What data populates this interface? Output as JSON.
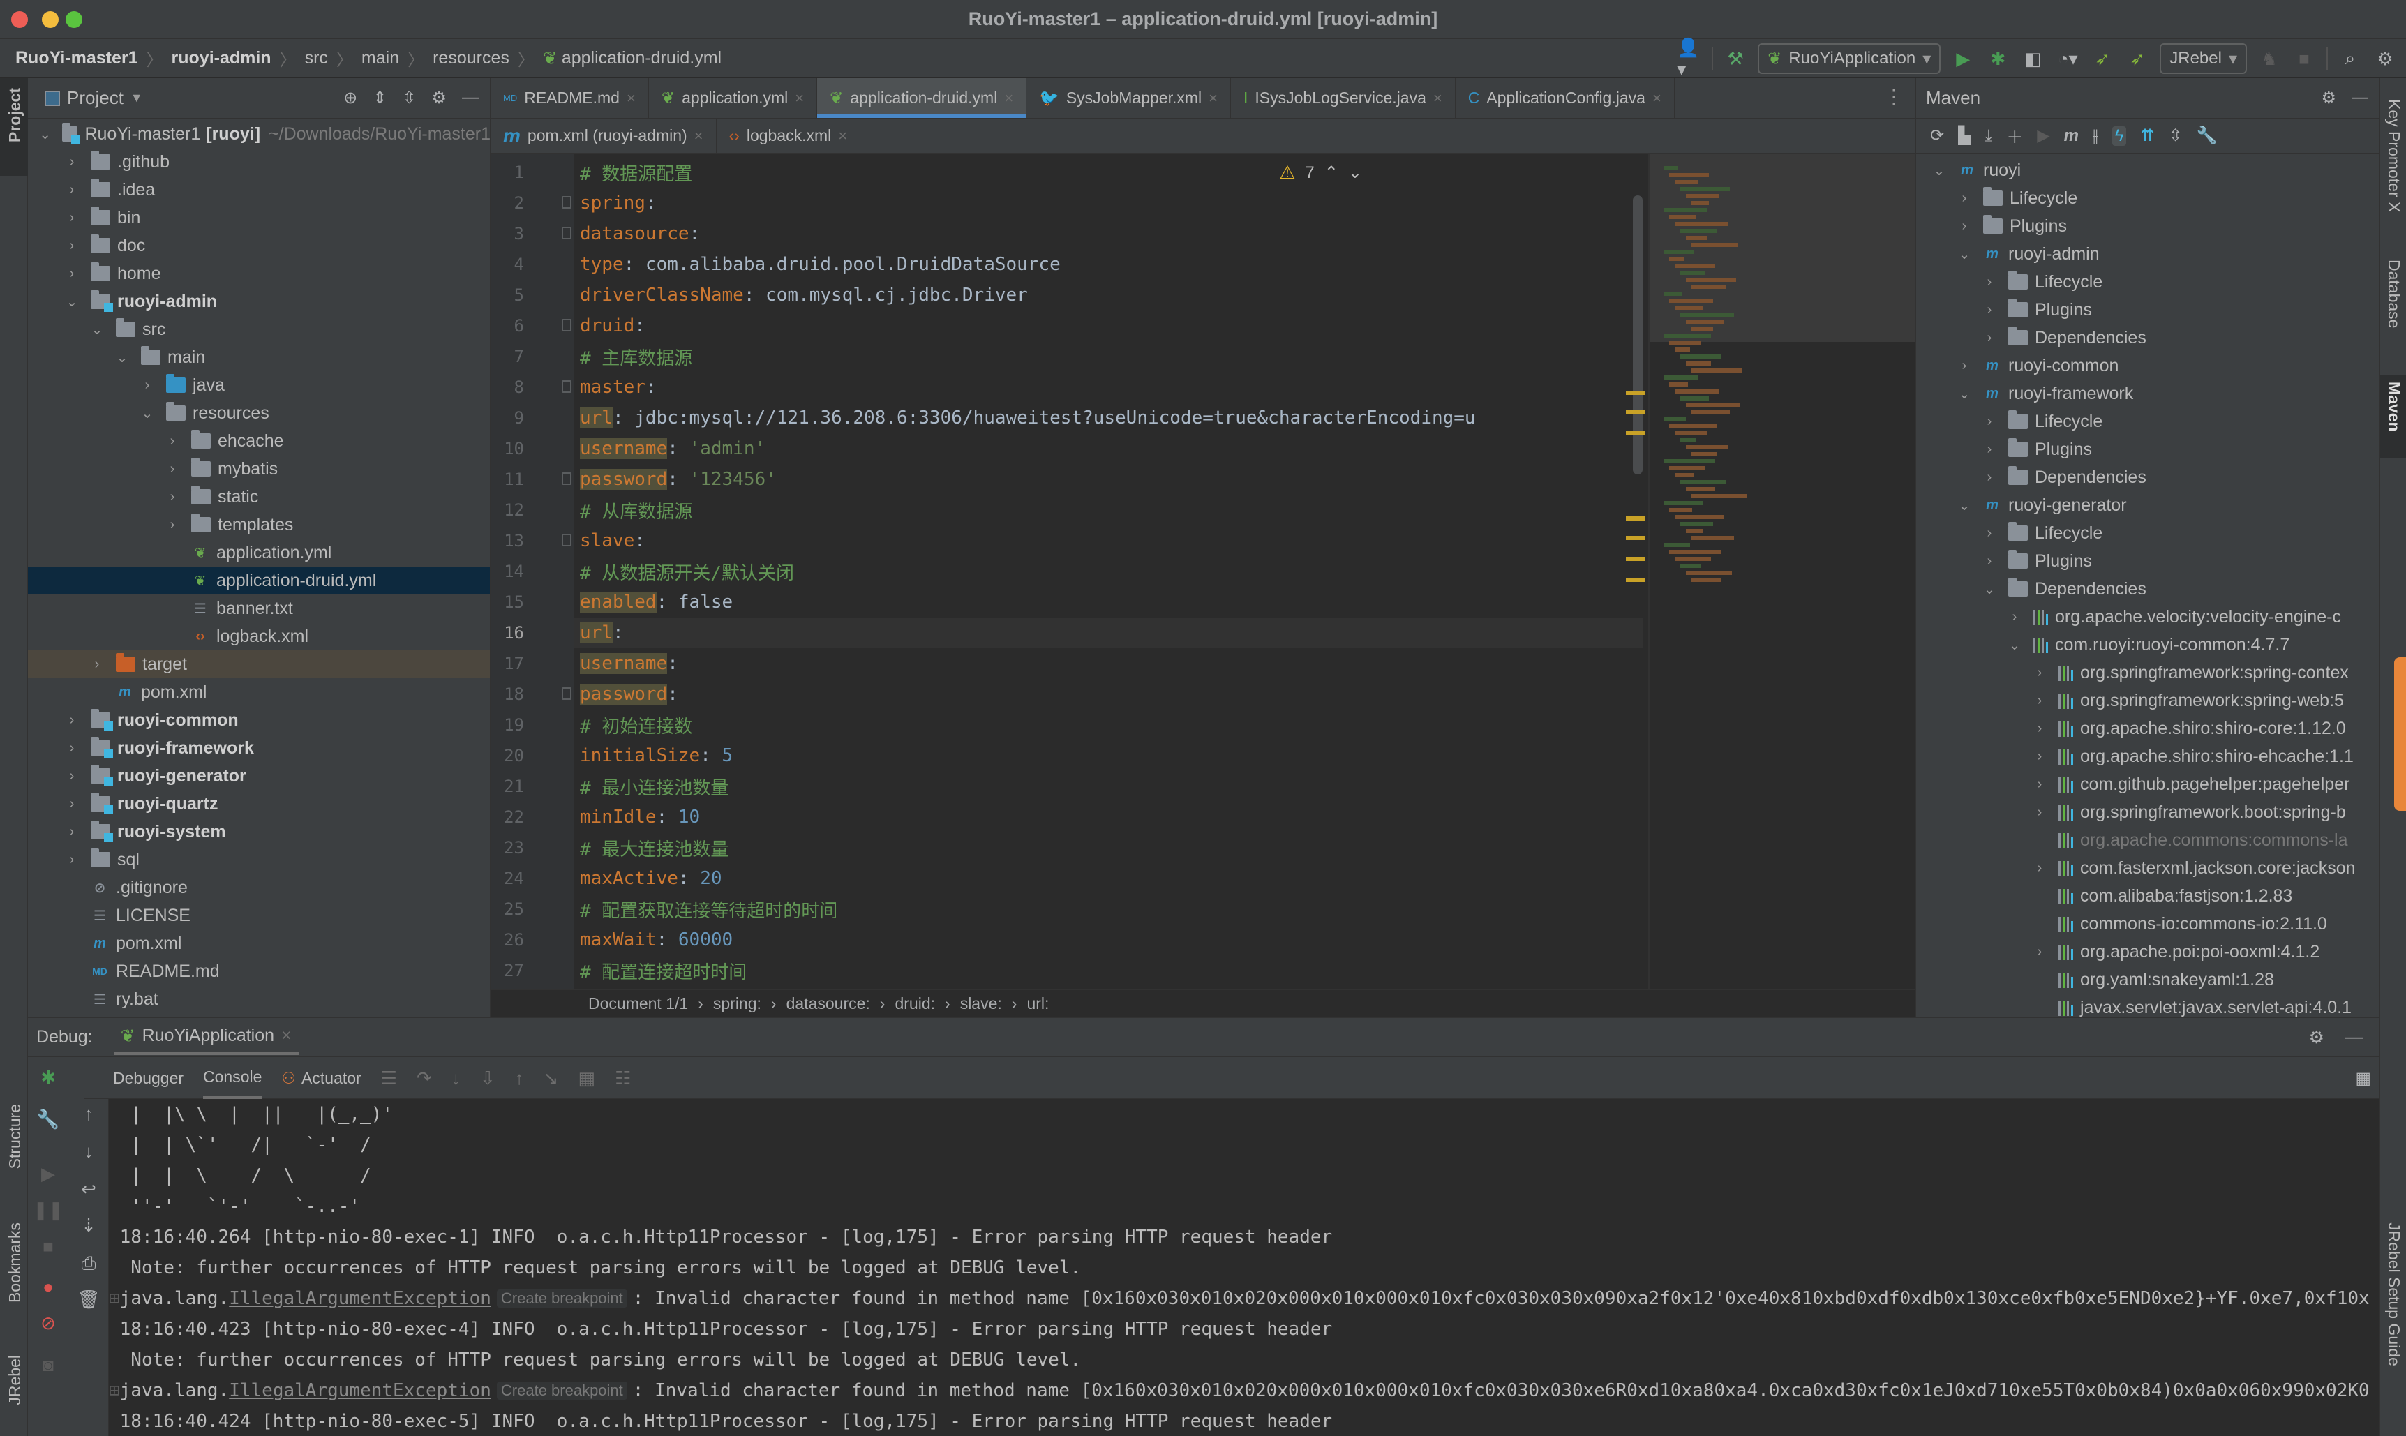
{
  "window": {
    "title": "RuoYi-master1 – application-druid.yml [ruoyi-admin]"
  },
  "breadcrumb": [
    "RuoYi-master1",
    "ruoyi-admin",
    "src",
    "main",
    "resources",
    "application-druid.yml"
  ],
  "toolbar": {
    "run_config": "RuoYiApplication",
    "jrebel_config": "JRebel"
  },
  "left_strip": {
    "tabs": [
      "Project",
      "Structure",
      "Bookmarks",
      "JRebel"
    ]
  },
  "right_strip": {
    "tabs": [
      "Key Promoter X",
      "Database",
      "Maven",
      "JRebel Setup Guide"
    ]
  },
  "project": {
    "header": "Project",
    "root_name": "RuoYi-master1",
    "root_module": "[ruoyi]",
    "root_path": "~/Downloads/RuoYi-master1",
    "items": [
      {
        "label": ".github",
        "depth": 1,
        "type": "folder",
        "expanded": false
      },
      {
        "label": ".idea",
        "depth": 1,
        "type": "folder",
        "expanded": false
      },
      {
        "label": "bin",
        "depth": 1,
        "type": "folder",
        "expanded": false
      },
      {
        "label": "doc",
        "depth": 1,
        "type": "folder",
        "expanded": false
      },
      {
        "label": "home",
        "depth": 1,
        "type": "folder",
        "expanded": false
      },
      {
        "label": "ruoyi-admin",
        "depth": 1,
        "type": "module",
        "expanded": true
      },
      {
        "label": "src",
        "depth": 2,
        "type": "folder",
        "expanded": true
      },
      {
        "label": "main",
        "depth": 3,
        "type": "folder",
        "expanded": true
      },
      {
        "label": "java",
        "depth": 4,
        "type": "source",
        "expanded": false
      },
      {
        "label": "resources",
        "depth": 4,
        "type": "resources",
        "expanded": true
      },
      {
        "label": "ehcache",
        "depth": 5,
        "type": "folder",
        "expanded": false
      },
      {
        "label": "mybatis",
        "depth": 5,
        "type": "folder",
        "expanded": false
      },
      {
        "label": "static",
        "depth": 5,
        "type": "folder",
        "expanded": false
      },
      {
        "label": "templates",
        "depth": 5,
        "type": "folder",
        "expanded": false
      },
      {
        "label": "application.yml",
        "depth": 5,
        "type": "spring"
      },
      {
        "label": "application-druid.yml",
        "depth": 5,
        "type": "spring",
        "selected": true
      },
      {
        "label": "banner.txt",
        "depth": 5,
        "type": "text"
      },
      {
        "label": "logback.xml",
        "depth": 5,
        "type": "xml"
      },
      {
        "label": "target",
        "depth": 2,
        "type": "excluded",
        "expanded": false
      },
      {
        "label": "pom.xml",
        "depth": 2,
        "type": "maven"
      },
      {
        "label": "ruoyi-common",
        "depth": 1,
        "type": "module",
        "expanded": false
      },
      {
        "label": "ruoyi-framework",
        "depth": 1,
        "type": "module",
        "expanded": false
      },
      {
        "label": "ruoyi-generator",
        "depth": 1,
        "type": "module",
        "expanded": false
      },
      {
        "label": "ruoyi-quartz",
        "depth": 1,
        "type": "module",
        "expanded": false
      },
      {
        "label": "ruoyi-system",
        "depth": 1,
        "type": "module",
        "expanded": false
      },
      {
        "label": "sql",
        "depth": 1,
        "type": "folder",
        "expanded": false
      },
      {
        "label": ".gitignore",
        "depth": 1,
        "type": "ignore"
      },
      {
        "label": "LICENSE",
        "depth": 1,
        "type": "text"
      },
      {
        "label": "pom.xml",
        "depth": 1,
        "type": "maven"
      },
      {
        "label": "README.md",
        "depth": 1,
        "type": "md"
      },
      {
        "label": "ry.bat",
        "depth": 1,
        "type": "text"
      }
    ]
  },
  "editor_tabs": {
    "row1": [
      {
        "label": "README.md",
        "icon": "markdown-icon"
      },
      {
        "label": "application.yml",
        "icon": "spring-icon"
      },
      {
        "label": "application-druid.yml",
        "icon": "spring-icon",
        "active": true
      },
      {
        "label": "SysJobMapper.xml",
        "icon": "mybatis-icon"
      },
      {
        "label": "ISysJobLogService.java",
        "icon": "interface-icon"
      },
      {
        "label": "ApplicationConfig.java",
        "icon": "class-icon"
      }
    ],
    "row2": [
      {
        "label": "pom.xml (ruoyi-admin)",
        "icon": "maven-icon"
      },
      {
        "label": "logback.xml",
        "icon": "xml-icon"
      }
    ]
  },
  "editor": {
    "warning_count": "7",
    "current_line": 16,
    "lines": [
      {
        "n": "1",
        "html": "<span class='c'># 数据源配置</span>"
      },
      {
        "n": "2",
        "html": "<span class='k'>spring</span>:"
      },
      {
        "n": "3",
        "html": "    <span class='k'>datasource</span>:"
      },
      {
        "n": "4",
        "html": "        <span class='k'>type</span>: <span class='v'>com.alibaba.druid.pool.DruidDataSource</span>"
      },
      {
        "n": "5",
        "html": "        <span class='k'>driverClassName</span>: <span class='v'>com.mysql.cj.jdbc.Driver</span>"
      },
      {
        "n": "6",
        "html": "        <span class='k'>druid</span>:"
      },
      {
        "n": "7",
        "html": "            <span class='c'># 主库数据源</span>"
      },
      {
        "n": "8",
        "html": "            <span class='k'>master</span>:"
      },
      {
        "n": "9",
        "html": "                <span class='k hl'>url</span>: <span class='v'>jdbc:mysql://121.36.208.6:3306/huaweitest?useUnicode=true&amp;characterEncoding=u</span>"
      },
      {
        "n": "10",
        "html": "                <span class='k hl'>username</span>: <span class='s'>'admin'</span>"
      },
      {
        "n": "11",
        "html": "                <span class='k hl'>password</span>: <span class='s'>'123456'</span>"
      },
      {
        "n": "12",
        "html": "            <span class='c'># 从库数据源</span>"
      },
      {
        "n": "13",
        "html": "            <span class='k'>slave</span>:"
      },
      {
        "n": "14",
        "html": "                <span class='c'># 从数据源开关/默认关闭</span>"
      },
      {
        "n": "15",
        "html": "                <span class='k hl'>enabled</span>: <span class='v'>false</span>"
      },
      {
        "n": "16",
        "html": "                <span class='k hl'>url</span>:"
      },
      {
        "n": "17",
        "html": "                <span class='k hl'>username</span>:"
      },
      {
        "n": "18",
        "html": "                <span class='k hl'>password</span>:"
      },
      {
        "n": "19",
        "html": "            <span class='c'># 初始连接数</span>"
      },
      {
        "n": "20",
        "html": "            <span class='k'>initialSize</span>: <span class='n'>5</span>"
      },
      {
        "n": "21",
        "html": "            <span class='c'># 最小连接池数量</span>"
      },
      {
        "n": "22",
        "html": "            <span class='k'>minIdle</span>: <span class='n'>10</span>"
      },
      {
        "n": "23",
        "html": "            <span class='c'># 最大连接池数量</span>"
      },
      {
        "n": "24",
        "html": "            <span class='k'>maxActive</span>: <span class='n'>20</span>"
      },
      {
        "n": "25",
        "html": "            <span class='c'># 配置获取连接等待超时的时间</span>"
      },
      {
        "n": "26",
        "html": "            <span class='k'>maxWait</span>: <span class='n'>60000</span>"
      },
      {
        "n": "27",
        "html": "            <span class='c'># 配置连接超时时间</span>"
      }
    ],
    "status_path": [
      "Document 1/1",
      "spring:",
      "datasource:",
      "druid:",
      "slave:",
      "url:"
    ]
  },
  "maven": {
    "title": "Maven",
    "items": [
      {
        "label": "ruoyi",
        "depth": 0,
        "type": "project",
        "expanded": true
      },
      {
        "label": "Lifecycle",
        "depth": 1,
        "type": "lifecycle",
        "expanded": false
      },
      {
        "label": "Plugins",
        "depth": 1,
        "type": "lifecycle",
        "expanded": false
      },
      {
        "label": "ruoyi-admin",
        "depth": 1,
        "type": "project",
        "expanded": true
      },
      {
        "label": "Lifecycle",
        "depth": 2,
        "type": "lifecycle",
        "expanded": false
      },
      {
        "label": "Plugins",
        "depth": 2,
        "type": "lifecycle",
        "expanded": false
      },
      {
        "label": "Dependencies",
        "depth": 2,
        "type": "deps",
        "expanded": false
      },
      {
        "label": "ruoyi-common",
        "depth": 1,
        "type": "project",
        "expanded": false
      },
      {
        "label": "ruoyi-framework",
        "depth": 1,
        "type": "project",
        "expanded": true
      },
      {
        "label": "Lifecycle",
        "depth": 2,
        "type": "lifecycle",
        "expanded": false
      },
      {
        "label": "Plugins",
        "depth": 2,
        "type": "lifecycle",
        "expanded": false
      },
      {
        "label": "Dependencies",
        "depth": 2,
        "type": "deps",
        "expanded": false
      },
      {
        "label": "ruoyi-generator",
        "depth": 1,
        "type": "project",
        "expanded": true
      },
      {
        "label": "Lifecycle",
        "depth": 2,
        "type": "lifecycle",
        "expanded": false
      },
      {
        "label": "Plugins",
        "depth": 2,
        "type": "lifecycle",
        "expanded": false
      },
      {
        "label": "Dependencies",
        "depth": 2,
        "type": "deps",
        "expanded": true
      },
      {
        "label": "org.apache.velocity:velocity-engine-c",
        "depth": 3,
        "type": "lib",
        "expanded": false
      },
      {
        "label": "com.ruoyi:ruoyi-common:4.7.7",
        "depth": 3,
        "type": "lib",
        "expanded": true
      },
      {
        "label": "org.springframework:spring-contex",
        "depth": 4,
        "type": "lib",
        "expanded": false
      },
      {
        "label": "org.springframework:spring-web:5",
        "depth": 4,
        "type": "lib",
        "expanded": false
      },
      {
        "label": "org.apache.shiro:shiro-core:1.12.0",
        "depth": 4,
        "type": "lib",
        "expanded": false
      },
      {
        "label": "org.apache.shiro:shiro-ehcache:1.1",
        "depth": 4,
        "type": "lib",
        "expanded": false
      },
      {
        "label": "com.github.pagehelper:pagehelper",
        "depth": 4,
        "type": "lib",
        "expanded": false
      },
      {
        "label": "org.springframework.boot:spring-b",
        "depth": 4,
        "type": "lib",
        "expanded": false
      },
      {
        "label": "org.apache.commons:commons-la",
        "depth": 4,
        "type": "lib",
        "dim": true
      },
      {
        "label": "com.fasterxml.jackson.core:jackson",
        "depth": 4,
        "type": "lib",
        "expanded": false
      },
      {
        "label": "com.alibaba:fastjson:1.2.83",
        "depth": 4,
        "type": "lib"
      },
      {
        "label": "commons-io:commons-io:2.11.0",
        "depth": 4,
        "type": "lib"
      },
      {
        "label": "org.apache.poi:poi-ooxml:4.1.2",
        "depth": 4,
        "type": "lib",
        "expanded": false
      },
      {
        "label": "org.yaml:snakeyaml:1.28",
        "depth": 4,
        "type": "lib"
      },
      {
        "label": "javax.servlet:javax.servlet-api:4.0.1",
        "depth": 4,
        "type": "lib"
      }
    ]
  },
  "debug": {
    "label": "Debug:",
    "session": "RuoYiApplication",
    "tabs": [
      "Debugger",
      "Console",
      "Actuator"
    ],
    "active_tab": "Console",
    "breakpoint_hint": "Create breakpoint",
    "console_lines": [
      {
        "type": "plain",
        "text": "  |  |\\ \\  |  ||   |(_,_)'"
      },
      {
        "type": "plain",
        "text": "  |  | \\`'   /|   `-'  /"
      },
      {
        "type": "plain",
        "text": "  |  |  \\    /  \\      /"
      },
      {
        "type": "plain",
        "text": "  ''-'   `'-'    `-..-'"
      },
      {
        "type": "plain",
        "text": " 18:16:40.264 [http-nio-80-exec-1] INFO  o.a.c.h.Http11Processor - [log,175] - Error parsing HTTP request header"
      },
      {
        "type": "plain",
        "text": "  Note: further occurrences of HTTP request parsing errors will be logged at DEBUG level."
      },
      {
        "type": "exception",
        "prefix": "java.lang.",
        "exception": "IllegalArgumentException",
        "text": ": Invalid character found in method name [0x160x030x010x020x000x010x000x010xfc0x030x030x090xa2f0x12'0xe40x810xbd0xdf0xdb0x130xce0xfb0xe5END0xe2}+YF.0xe7,0xf10x"
      },
      {
        "type": "plain",
        "text": " 18:16:40.423 [http-nio-80-exec-4] INFO  o.a.c.h.Http11Processor - [log,175] - Error parsing HTTP request header"
      },
      {
        "type": "plain",
        "text": "  Note: further occurrences of HTTP request parsing errors will be logged at DEBUG level."
      },
      {
        "type": "exception",
        "prefix": "java.lang.",
        "exception": "IllegalArgumentException",
        "text": ": Invalid character found in method name [0x160x030x010x020x000x010x000x010xfc0x030x030xe6R0xd10xa80xa4.0xca0xd30xfc0x1eJ0xd710xe55T0x0b0x84)0x0a0x060x990x02K0"
      },
      {
        "type": "plain",
        "text": " 18:16:40.424 [http-nio-80-exec-5] INFO  o.a.c.h.Http11Processor - [log,175] - Error parsing HTTP request header"
      }
    ]
  }
}
